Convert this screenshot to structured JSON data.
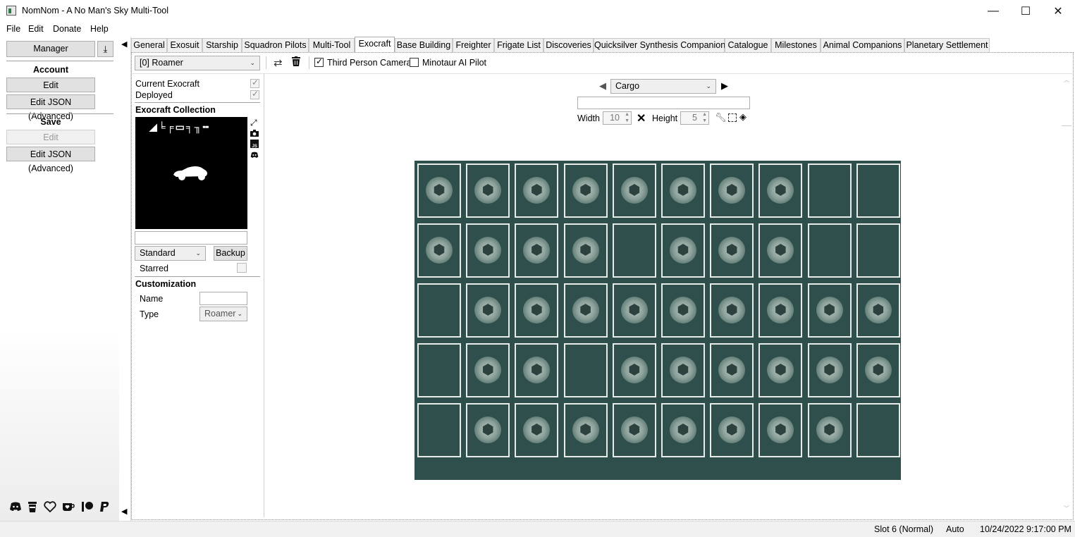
{
  "window": {
    "title": "NomNom - A No Man's Sky Multi-Tool",
    "minimize": "—",
    "maximize": "☐",
    "close": "✕"
  },
  "menu": [
    "File",
    "Edit",
    "Donate",
    "Help"
  ],
  "left": {
    "manager": "Manager",
    "account_heading": "Account",
    "account_edit": "Edit",
    "account_json": "Edit JSON (Advanced)",
    "save_heading": "Save",
    "save_edit": "Edit",
    "save_json": "Edit JSON (Advanced)"
  },
  "tabs": [
    "General",
    "Exosuit",
    "Starship",
    "Squadron Pilots",
    "Multi-Tool",
    "Exocraft",
    "Base Building",
    "Freighter",
    "Frigate List",
    "Discoveries",
    "Quicksilver Synthesis Companion",
    "Catalogue",
    "Milestones",
    "Animal Companions",
    "Planetary Settlement"
  ],
  "active_tab": "Exocraft",
  "toolbar": {
    "vehicle": "[0] Roamer",
    "third_person": "Third Person Camera",
    "third_person_checked": true,
    "minotaur": "Minotaur AI Pilot",
    "minotaur_checked": false
  },
  "exocraft": {
    "current": "Current Exocraft",
    "current_checked": true,
    "deployed": "Deployed",
    "deployed_checked": true,
    "collection_heading": "Exocraft Collection",
    "preview_glyphs": "◢╘╒▭╕╖╍",
    "preview_name": "",
    "mode": "Standard",
    "backup": "Backup",
    "starred": "Starred",
    "starred_checked": false,
    "customization_heading": "Customization",
    "name_label": "Name",
    "name_value": "",
    "type_label": "Type",
    "type_value": "Roamer"
  },
  "inventory": {
    "name": "Cargo",
    "search": "",
    "width_label": "Width",
    "width": "10",
    "height_label": "Height",
    "height": "5",
    "rows": [
      [
        1,
        1,
        1,
        1,
        1,
        1,
        1,
        1,
        0,
        0
      ],
      [
        1,
        1,
        1,
        1,
        0,
        1,
        1,
        1,
        0,
        0
      ],
      [
        0,
        1,
        1,
        1,
        1,
        1,
        1,
        1,
        1,
        1
      ],
      [
        0,
        1,
        1,
        0,
        1,
        1,
        1,
        1,
        1,
        1
      ],
      [
        0,
        1,
        1,
        1,
        1,
        1,
        1,
        1,
        1,
        0
      ]
    ],
    "item_icon": "cargo-module-icon",
    "colors": {
      "grid_bg": "#2f4f4c",
      "slot_border": "#e8ece9"
    }
  },
  "status": {
    "slot": "Slot 6 (Normal)",
    "mode": "Auto",
    "datetime": "10/24/2022 9:17:00 PM"
  }
}
